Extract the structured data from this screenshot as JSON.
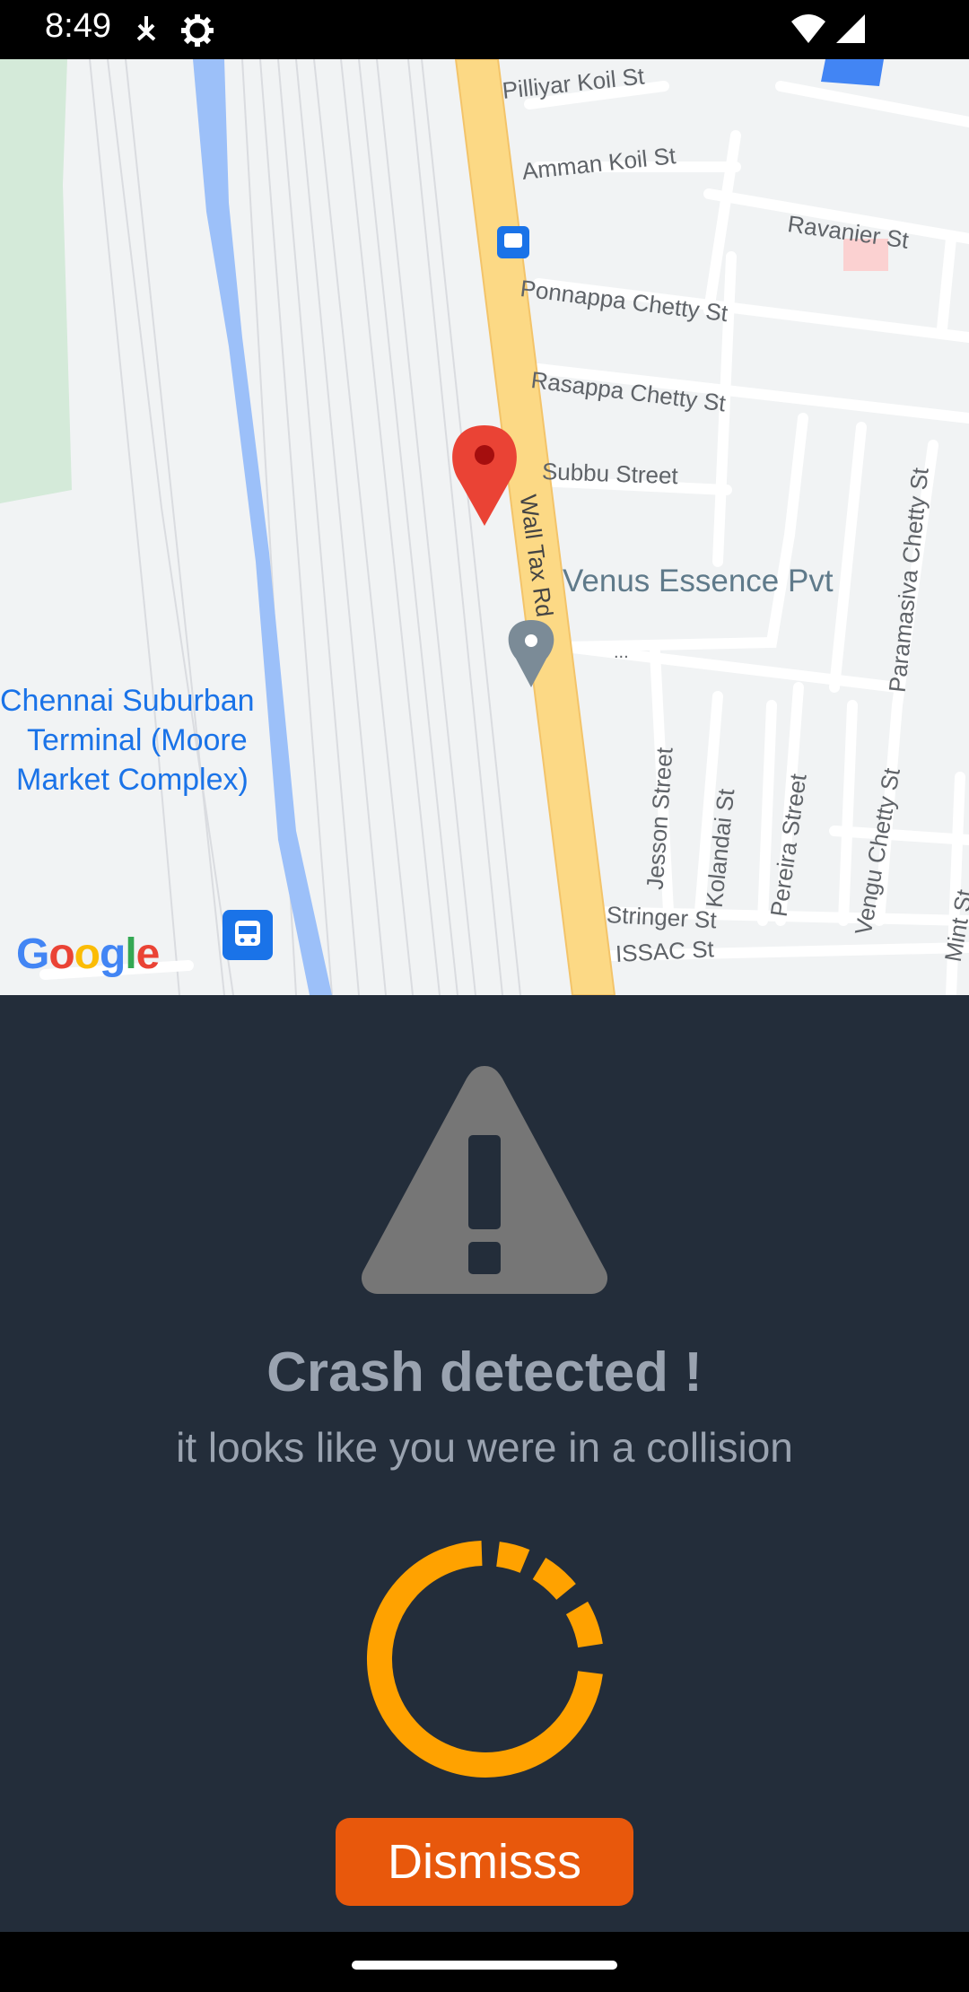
{
  "status_bar": {
    "time": "8:49",
    "icons": [
      "download-icon",
      "settings-gear-icon",
      "wifi-icon",
      "signal-icon"
    ]
  },
  "map": {
    "labels": {
      "pilliyar": "Pilliyar Koil St",
      "amman": "Amman Koil St",
      "ravanier": "Ravanier St",
      "ponnappa": "Ponnappa Chetty St",
      "rasappa": "Rasappa Chetty St",
      "subbu": "Subbu Street",
      "wall_tax": "Wall Tax Rd",
      "venus": "Venus Essence Pvt",
      "venus_more": "...",
      "paramasiva": "Paramasiva Chetty St",
      "terminal_1": "Chennai Suburban",
      "terminal_2": "Terminal (Moore",
      "terminal_3": "Market Complex)",
      "jesson": "Jesson Street",
      "kolandai": "Kolandai St",
      "pereira": "Pereira Street",
      "vengu": "Vengu Chetty St",
      "stringer": "Stringer St",
      "issac": "ISSAC St",
      "mint": "Mint St"
    },
    "google_logo": "Google",
    "colors": {
      "land": "#f1f3f4",
      "main_road": "#fcd985",
      "water": "#9cc0f9",
      "park": "#d4ead9",
      "marker": "#ea4335"
    }
  },
  "alert": {
    "icon": "warning-triangle-icon",
    "title": "Crash detected !",
    "subtitle": "it looks like you were in a collision",
    "countdown_icon": "countdown-ring-icon",
    "dismiss_label": "Dismisss",
    "colors": {
      "background": "#232d3a",
      "text": "#9aa3b0",
      "ring": "#ffa200",
      "button": "#e8580c"
    }
  }
}
